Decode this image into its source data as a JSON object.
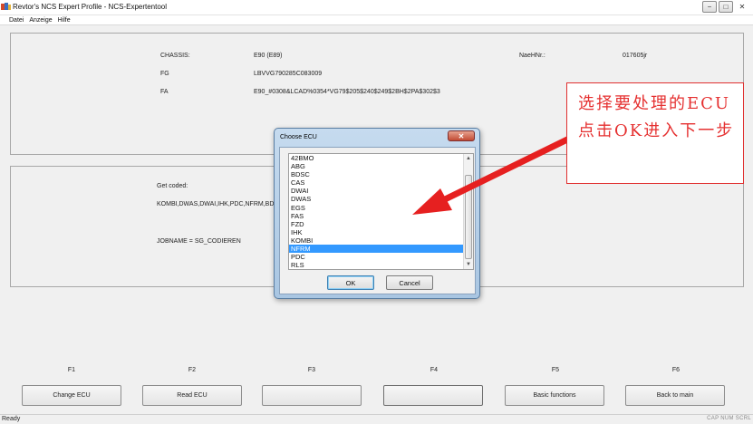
{
  "window": {
    "title": "Revtor's NCS Expert Profile - NCS-Expertentool",
    "controls": [
      "minimize-icon",
      "maximize-icon",
      "close-icon"
    ]
  },
  "menu": [
    "Datei",
    "Anzeige",
    "Hilfe"
  ],
  "vehicle": {
    "chassis_label": "CHASSIS:",
    "chassis_value": "E90 (E89)",
    "fg_label": "FG",
    "fg_value": "LBVVG790285C083009",
    "fa_label": "FA",
    "fa_value": "E90_#0308&LCAD%0354*VG79$205$240$249$2BH$2PA$302$3",
    "nael_label": "NaeHNr.:",
    "nael_value": "017605jr"
  },
  "job": {
    "got_coded_label": "Get coded:",
    "coded_list": "KOMBI,DWAS,DWAI,IHK,PDC,NFRM,BDSC",
    "jobname": "JOBNAME = SG_CODIEREN"
  },
  "dialog": {
    "title": "Choose ECU",
    "items": [
      "42BMO",
      "ABG",
      "BDSC",
      "CAS",
      "DWAI",
      "DWAS",
      "EGS",
      "FAS",
      "FZD",
      "IHK",
      "KOMBI",
      "NFRM",
      "PDC",
      "RLS"
    ],
    "selected": "NFRM",
    "ok_label": "OK",
    "cancel_label": "Cancel"
  },
  "function_keys": [
    {
      "key": "F1",
      "label": "Change ECU"
    },
    {
      "key": "F2",
      "label": "Read ECU"
    },
    {
      "key": "F3",
      "label": ""
    },
    {
      "key": "F4",
      "label": ""
    },
    {
      "key": "F5",
      "label": "Basic functions"
    },
    {
      "key": "F6",
      "label": "Back to main"
    }
  ],
  "status": {
    "text": "Ready",
    "indicators": "CAP  NUM  SCRL"
  },
  "annotation": {
    "text": "选择要处理的ECU点击OK进入下一步"
  },
  "colors": {
    "selection": "#3399ff",
    "annotation_red": "#e53030",
    "dialog_frame": "#a9c6e2"
  }
}
